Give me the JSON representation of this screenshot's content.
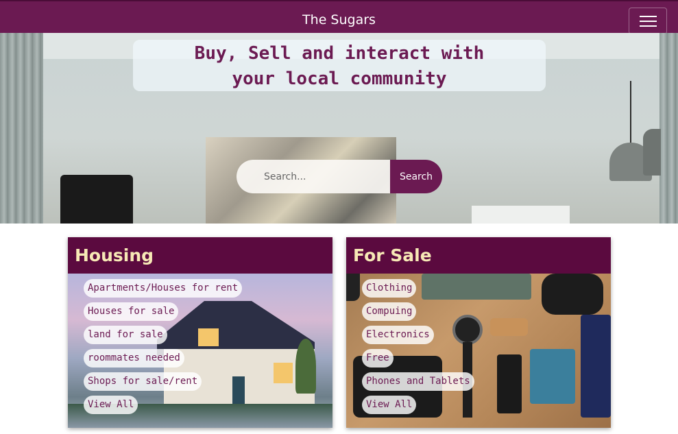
{
  "navbar": {
    "brand": "The Sugars",
    "menu_icon": "hamburger-menu-icon",
    "color": "#6b1a52"
  },
  "hero": {
    "headline_line1": "Buy, Sell and interact with",
    "headline_line2": "your local community",
    "search": {
      "placeholder": "Search...",
      "value": "",
      "button_label": "Search"
    }
  },
  "categories": [
    {
      "title": "Housing",
      "links": [
        "Apartments/Houses for rent",
        "Houses for sale",
        "land for sale",
        "roommates needed",
        "Shops for sale/rent",
        "View All"
      ]
    },
    {
      "title": "For Sale",
      "links": [
        "Clothing",
        "Compuing",
        "Electronics",
        "Free",
        "Phones and Tablets",
        "View All"
      ]
    }
  ],
  "colors": {
    "primary": "#6b1a52",
    "card_header": "#5b0a3f",
    "card_title": "#f7e9b6"
  }
}
